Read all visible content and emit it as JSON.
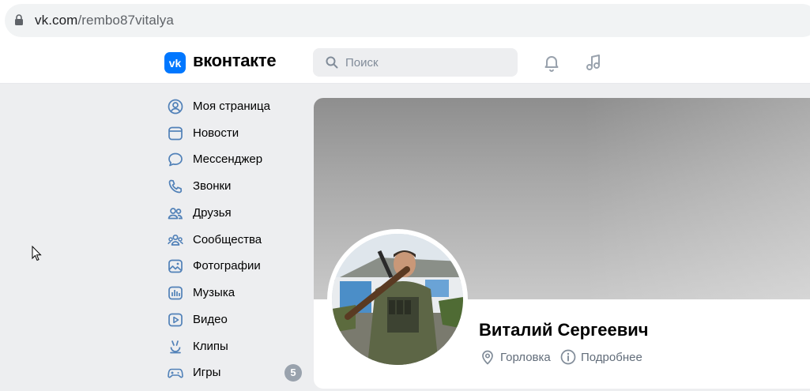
{
  "browser": {
    "url_domain": "vk.com",
    "url_path": "/rembo87vitalya"
  },
  "header": {
    "logo_text": "вконтакте",
    "search_placeholder": "Поиск"
  },
  "nav": {
    "items": [
      {
        "label": "Моя страница",
        "icon": "user-circle-icon"
      },
      {
        "label": "Новости",
        "icon": "news-icon"
      },
      {
        "label": "Мессенджер",
        "icon": "message-icon"
      },
      {
        "label": "Звонки",
        "icon": "phone-icon"
      },
      {
        "label": "Друзья",
        "icon": "friends-icon"
      },
      {
        "label": "Сообщества",
        "icon": "communities-icon"
      },
      {
        "label": "Фотографии",
        "icon": "photo-icon"
      },
      {
        "label": "Музыка",
        "icon": "music-bars-icon"
      },
      {
        "label": "Видео",
        "icon": "video-icon"
      },
      {
        "label": "Клипы",
        "icon": "clips-icon"
      },
      {
        "label": "Игры",
        "icon": "games-icon",
        "badge": "5"
      }
    ]
  },
  "profile": {
    "name": "Виталий Сергеевич",
    "city": "Горловка",
    "details_link": "Подробнее"
  },
  "colors": {
    "accent": "#0077ff",
    "icon": "#5181b8",
    "muted": "#626d7a"
  }
}
